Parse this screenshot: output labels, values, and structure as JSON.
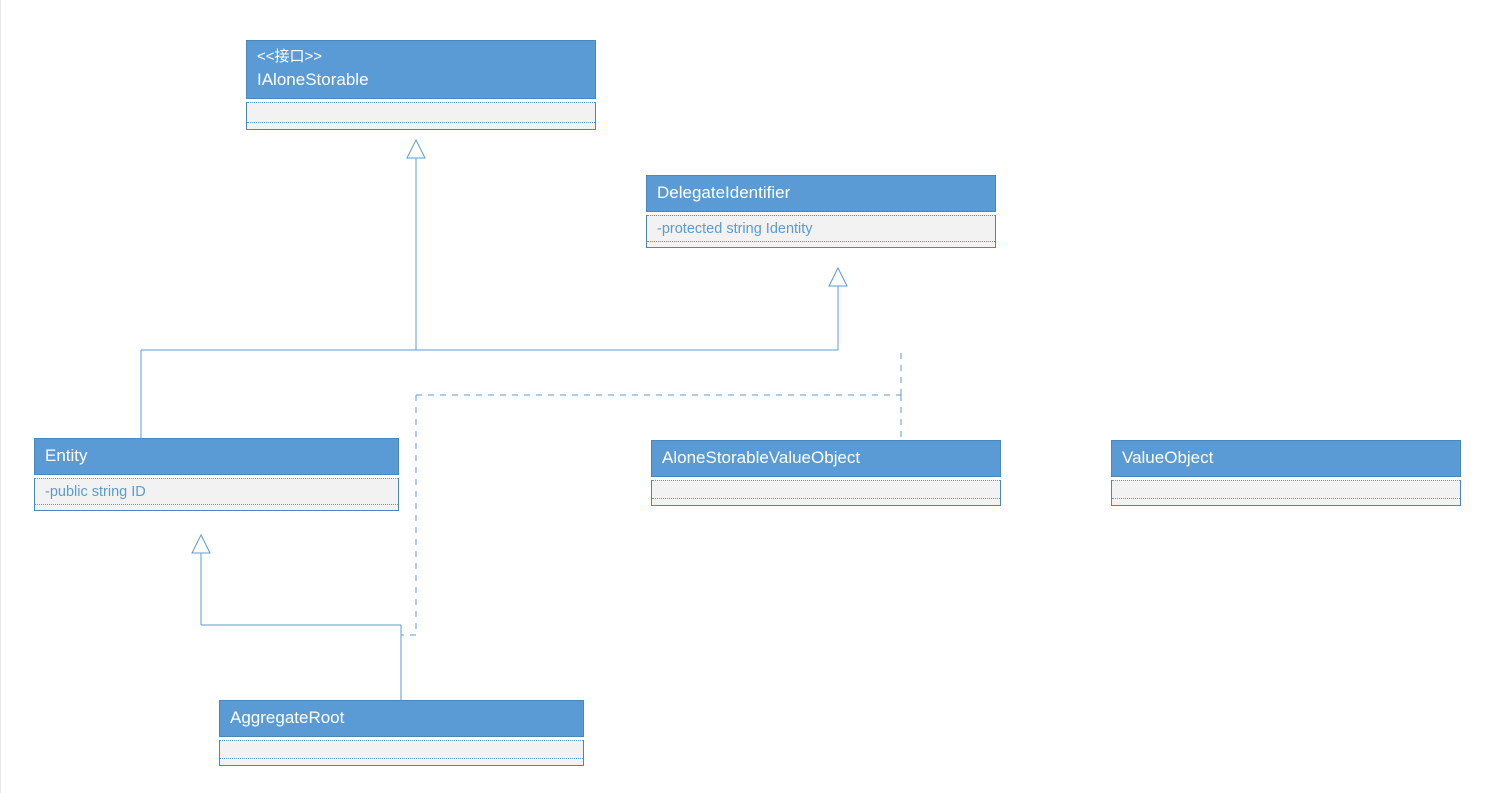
{
  "colors": {
    "boxFill": "#5b9bd5",
    "boxBorder": "#4a87bf",
    "body": "#f2f2f2",
    "text": "#ffffff",
    "member": "#5b9bd5"
  },
  "classes": {
    "ialone": {
      "stereotype": "<<接口>>",
      "name": "IAloneStorable",
      "members": []
    },
    "delegate": {
      "stereotype": "",
      "name": "DelegateIdentifier",
      "members": [
        "-protected string Identity"
      ]
    },
    "entity": {
      "stereotype": "",
      "name": "Entity",
      "members": [
        "-public string ID"
      ]
    },
    "asvo": {
      "stereotype": "",
      "name": "AloneStorableValueObject",
      "members": []
    },
    "vo": {
      "stereotype": "",
      "name": "ValueObject",
      "members": []
    },
    "aggroot": {
      "stereotype": "",
      "name": "AggregateRoot",
      "members": []
    }
  },
  "relationships": [
    {
      "from": "entity",
      "to": "ialone",
      "type": "realization-hollow-arrow",
      "style": "solid"
    },
    {
      "from": "asvo",
      "to": "ialone",
      "type": "realization-hollow-arrow",
      "style": "solid"
    },
    {
      "from": "entity",
      "to": "delegate",
      "type": "inheritance-hollow-arrow",
      "style": "solid"
    },
    {
      "from": "asvo",
      "to": "delegate",
      "type": "dependency",
      "style": "dashed"
    },
    {
      "from": "aggroot",
      "to": "entity",
      "type": "inheritance-hollow-arrow",
      "style": "solid"
    },
    {
      "from": "aggroot",
      "to": "ialone",
      "type": "dependency",
      "style": "dashed"
    }
  ]
}
